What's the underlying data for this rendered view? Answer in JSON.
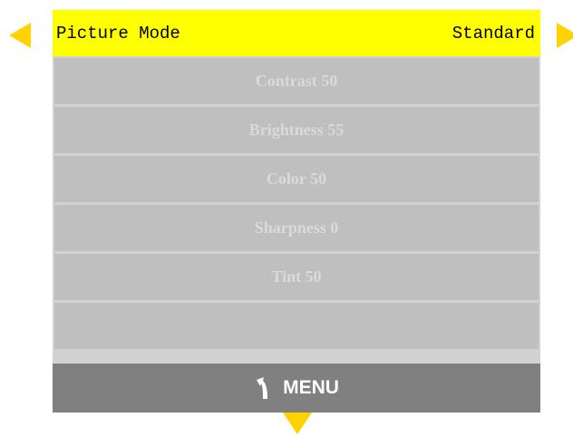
{
  "header": {
    "title": "Picture Mode",
    "value": "Standard"
  },
  "items": [
    {
      "label": "Contrast 50"
    },
    {
      "label": "Brightness 55"
    },
    {
      "label": "Color 50"
    },
    {
      "label": "Sharpness 0"
    },
    {
      "label": "Tint 50"
    },
    {
      "label": ""
    }
  ],
  "footer": {
    "menu_label": "MENU",
    "icon": "back-arrow-icon"
  },
  "nav": {
    "left_icon": "left-arrow-icon",
    "right_icon": "right-arrow-icon",
    "down_icon": "down-arrow-icon"
  },
  "colors": {
    "accent": "#ffff00",
    "arrow": "#ffd200",
    "item_bg": "#bfbfbf",
    "item_text": "#dadada",
    "footer_bg": "#808080"
  }
}
